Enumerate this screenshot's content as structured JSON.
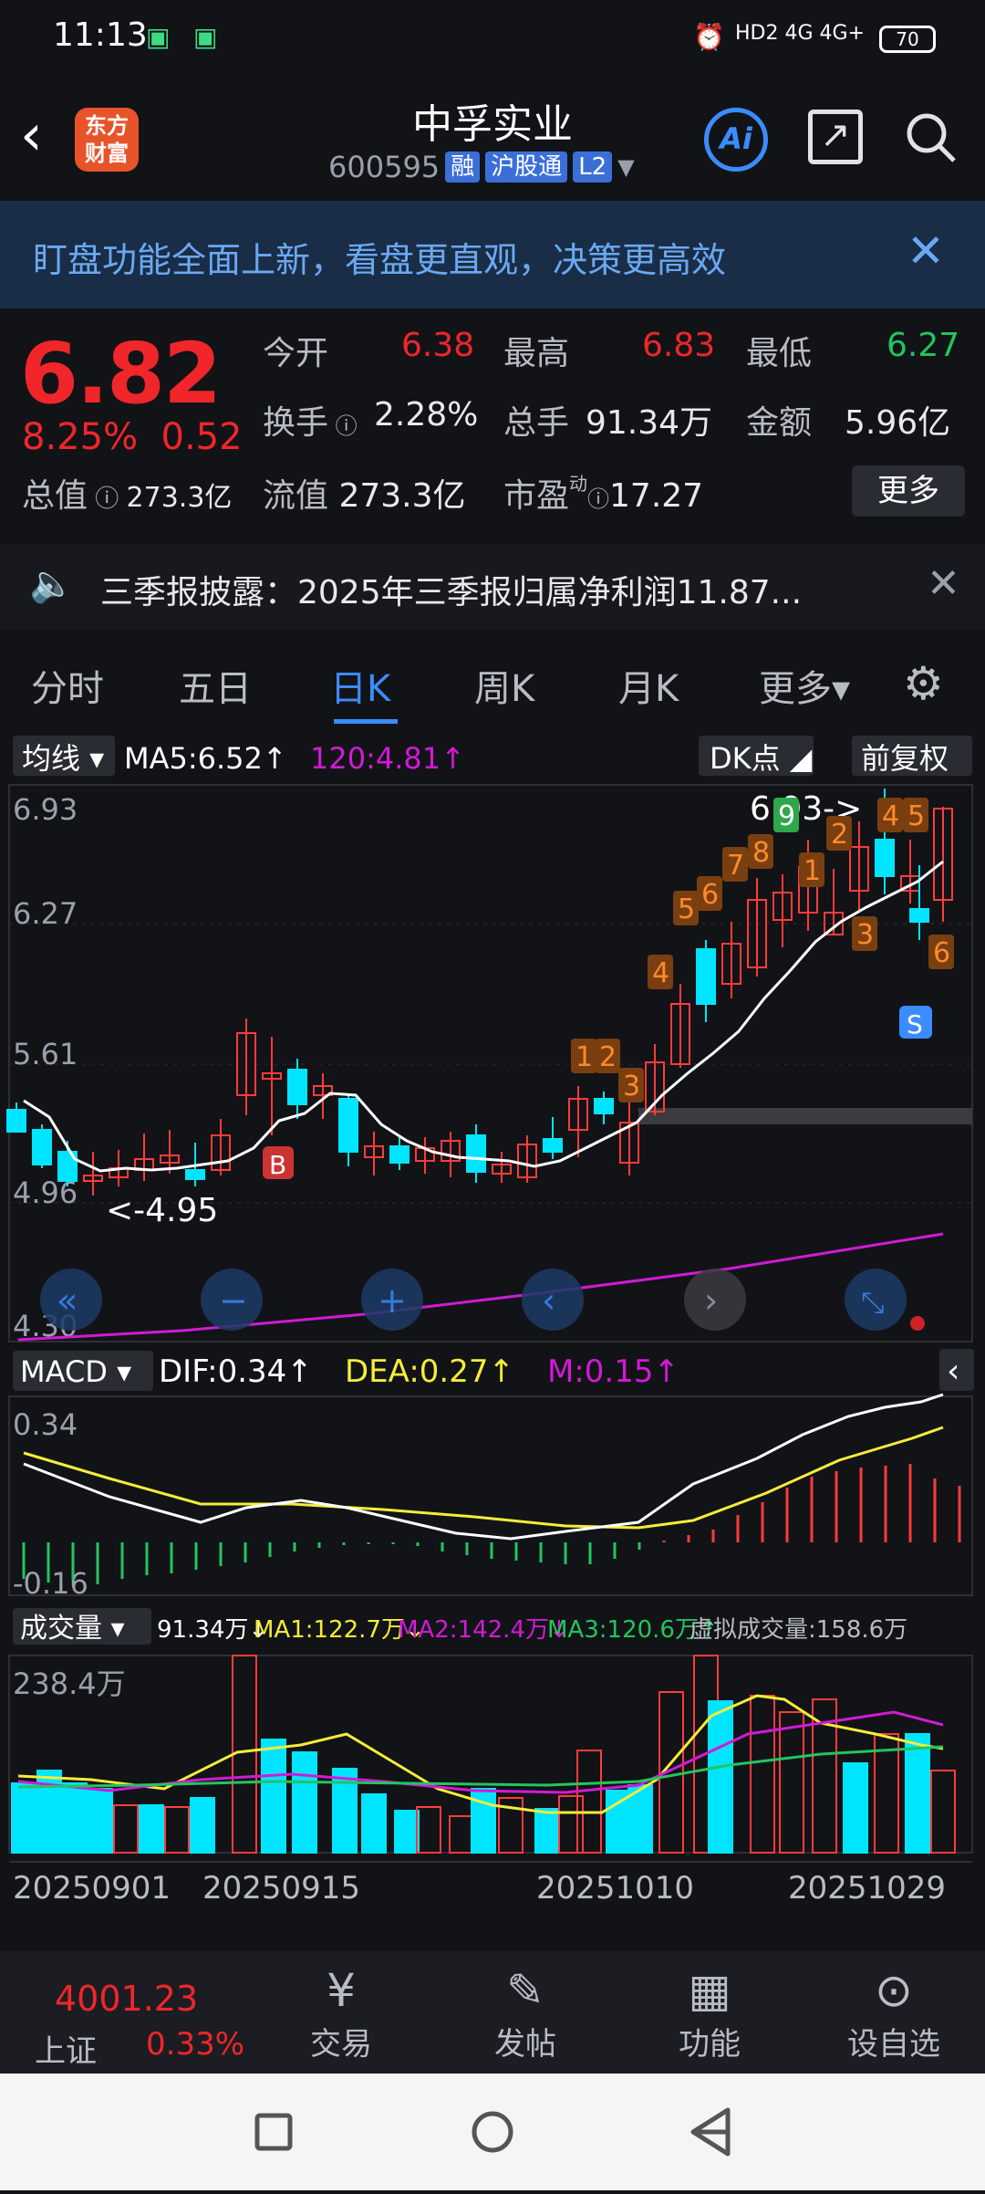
{
  "status": {
    "time": "11:13",
    "net": "HD2 4G 4G+",
    "battery": "70"
  },
  "header": {
    "logo": "东方财富",
    "title": "中孚实业",
    "code": "600595",
    "tags": [
      "融",
      "沪股通",
      "L2"
    ],
    "ai": "Ai"
  },
  "banner": {
    "text": "盯盘功能全面上新，看盘更直观，决策更高效"
  },
  "quote": {
    "price": "6.82",
    "pct": "8.25%",
    "chg": "0.52",
    "open_l": "今开",
    "open": "6.38",
    "high_l": "最高",
    "high": "6.83",
    "low_l": "最低",
    "low": "6.27",
    "turn_l": "换手",
    "turn": "2.28%",
    "vol_l": "总手",
    "vol": "91.34万",
    "amt_l": "金额",
    "amt": "5.96亿",
    "mcap_l": "总值",
    "mcap": "273.3亿",
    "float_l": "流值",
    "float": "273.3亿",
    "pe_l": "市盈",
    "pe": "17.27",
    "more": "更多"
  },
  "notice": {
    "text": "三季报披露：2025年三季报归属净利润11.87..."
  },
  "tabs": [
    "分时",
    "五日",
    "日K",
    "周K",
    "月K",
    "更多▾"
  ],
  "chart_panel": {
    "ma_btn": "均线 ▾",
    "ma5": "MA5:6.52↑",
    "ma120": "120:4.81↑",
    "dk": "DK点 ◢",
    "fq": "前复权",
    "yticks": [
      "6.93",
      "6.27",
      "5.61",
      "4.96",
      "4.30"
    ],
    "low_mark": "<-4.95",
    "high_mark": "6.93->",
    "macd_btn": "MACD ▾",
    "dif": "DIF:0.34↑",
    "dea": "DEA:0.27↑",
    "m": "M:0.15↑",
    "macd_ticks": [
      "0.34",
      "-0.16"
    ],
    "vol_btn": "成交量 ▾",
    "v0": "91.34万↓",
    "vma1": "MA1:122.7万↓",
    "vma2": "MA2:142.4万↓",
    "vma3": "MA3:120.6万↑",
    "vvirt": "虚拟成交量:158.6万",
    "vol_tick": "238.4万",
    "dates": [
      "20250901",
      "20250915",
      "20251010",
      "20251029"
    ],
    "seq": [
      "1",
      "2",
      "3",
      "4",
      "5",
      "6",
      "7",
      "8",
      "9",
      "1",
      "2",
      "3",
      "4",
      "5",
      "6"
    ],
    "b": "B",
    "s": "S"
  },
  "chart_data": {
    "type": "candlestick",
    "ylim": [
      4.3,
      6.93
    ],
    "colors": {
      "up": "#ff3b3b",
      "down": "#00e5ff",
      "ma5": "#ffffff",
      "ma120": "#d21ad6",
      "dea": "#f6ec3a"
    }
  },
  "index": {
    "value": "4001.23",
    "name": "上证",
    "pct": "0.33%"
  },
  "nav": [
    "交易",
    "发帖",
    "功能",
    "设自选"
  ]
}
